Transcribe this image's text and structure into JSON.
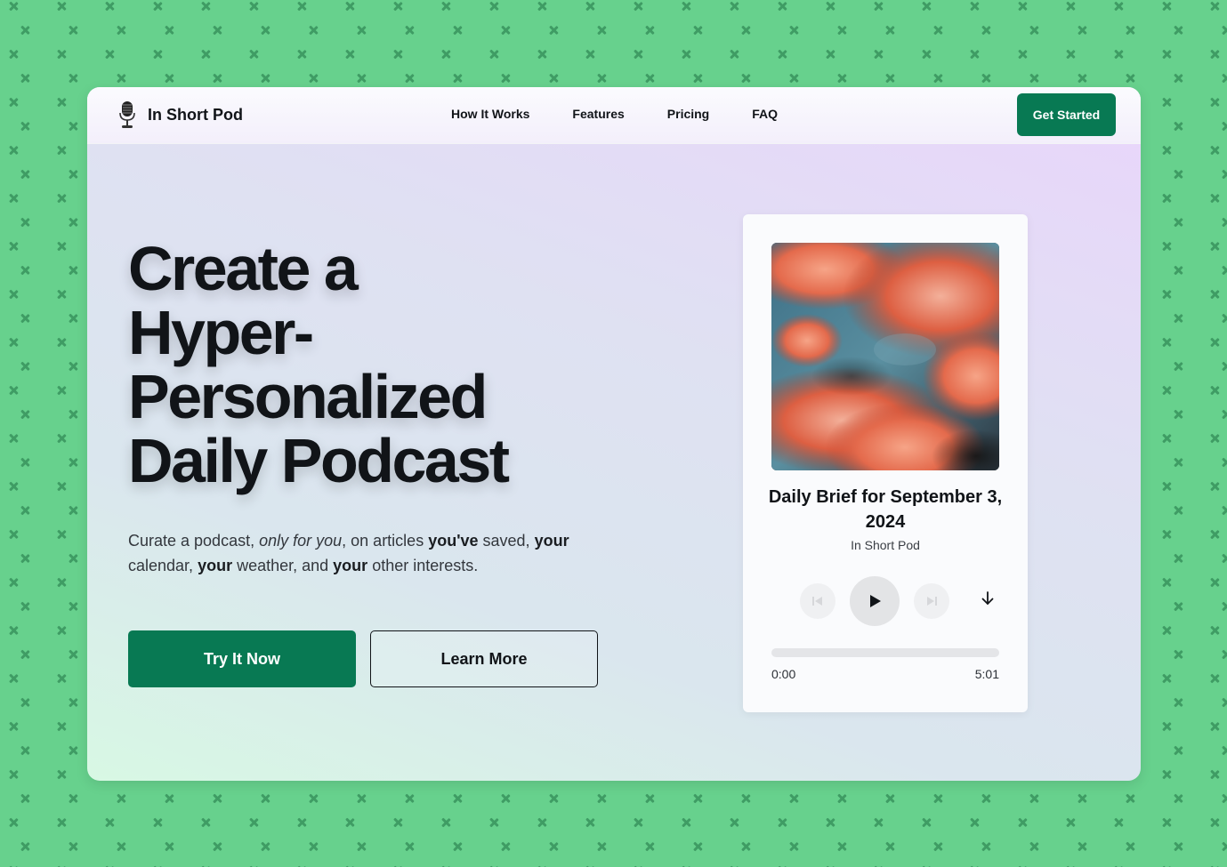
{
  "nav": {
    "brand": "In Short Pod",
    "links": [
      "How It Works",
      "Features",
      "Pricing",
      "FAQ"
    ],
    "cta": "Get Started"
  },
  "hero": {
    "title_lines": [
      "Create a",
      "Hyper-",
      "Personalized",
      "Daily Podcast"
    ],
    "subtitle": {
      "p1": "Curate a podcast, ",
      "p2": "only for you",
      "p3": ", on articles ",
      "p4": "you've",
      "p5": " saved, ",
      "p6": "your",
      "p7": " calendar, ",
      "p8": "your",
      "p9": " weather, and ",
      "p10": "your",
      "p11": " other interests."
    },
    "primary_button": "Try It Now",
    "secondary_button": "Learn More"
  },
  "player": {
    "cover_icon": "cloud-sunset-image",
    "episode_title": "Daily Brief for September 3, 2024",
    "podcast_name": "In Short Pod",
    "current_time": "0:00",
    "total_time": "5:01",
    "progress": 0,
    "controls": {
      "previous_icon": "skip-back-icon",
      "play_icon": "play-icon",
      "next_icon": "skip-forward-icon",
      "download_icon": "download-arrow-icon"
    }
  },
  "colors": {
    "page_background": "#67d18d",
    "pattern": "#3f9c64",
    "accent": "#087953",
    "text": "#111418"
  }
}
